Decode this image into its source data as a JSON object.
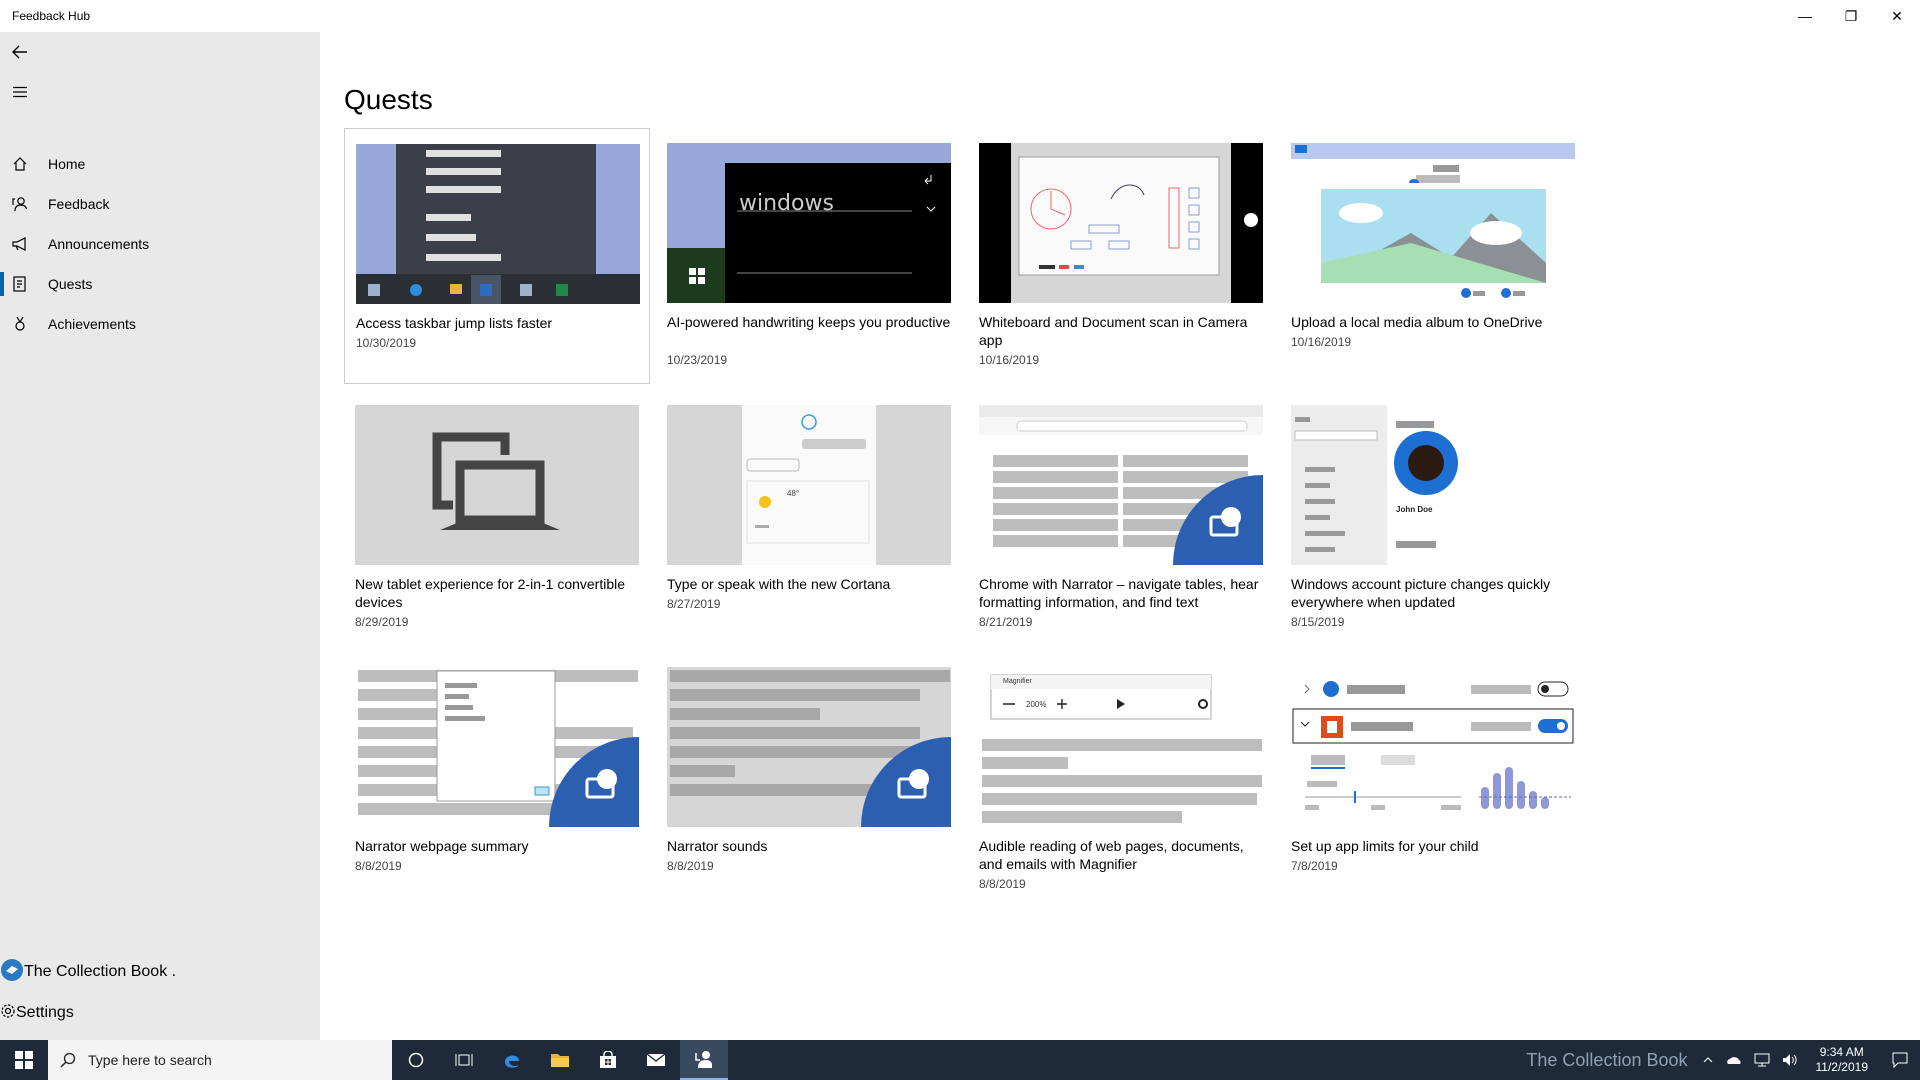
{
  "window": {
    "title": "Feedback Hub",
    "minimize": "—",
    "restore": "❐",
    "close": "✕"
  },
  "sidebar": {
    "items": [
      {
        "label": "Home",
        "icon": "home-icon"
      },
      {
        "label": "Feedback",
        "icon": "feedback-icon"
      },
      {
        "label": "Announcements",
        "icon": "megaphone-icon"
      },
      {
        "label": "Quests",
        "icon": "quest-icon",
        "active": true
      },
      {
        "label": "Achievements",
        "icon": "medal-icon"
      }
    ],
    "account_label": "The Collection Book .",
    "settings_label": "Settings"
  },
  "main": {
    "title": "Quests",
    "cards": [
      {
        "title": "Access taskbar jump lists faster",
        "date": "10/30/2019"
      },
      {
        "title": "AI-powered handwriting keeps you productive",
        "date": "10/23/2019",
        "thumb_text": "windows"
      },
      {
        "title": "Whiteboard and Document scan in Camera app",
        "date": "10/16/2019"
      },
      {
        "title": "Upload a local media album to OneDrive",
        "date": "10/16/2019"
      },
      {
        "title": "New tablet experience for 2-in-1 convertible devices",
        "date": "8/29/2019"
      },
      {
        "title": "Type or speak with the new Cortana",
        "date": "8/27/2019",
        "thumb_text": "48°"
      },
      {
        "title": "Chrome with Narrator – navigate tables, hear formatting information, and find text",
        "date": "8/21/2019"
      },
      {
        "title": "Windows account picture changes quickly everywhere when updated",
        "date": "8/15/2019",
        "thumb_text": "John Doe"
      },
      {
        "title": "Narrator webpage summary",
        "date": "8/8/2019"
      },
      {
        "title": "Narrator sounds",
        "date": "8/8/2019"
      },
      {
        "title": "Audible reading of web pages, documents, and emails with Magnifier",
        "date": "8/8/2019",
        "thumb_text": "Magnifier",
        "thumb_zoom": "200%"
      },
      {
        "title": "Set up app limits for your child",
        "date": "7/8/2019"
      }
    ]
  },
  "taskbar": {
    "search_placeholder": "Type here to search",
    "time": "9:34 AM",
    "date": "11/2/2019",
    "watermark": "The Collection Book"
  },
  "colors": {
    "accent": "#0063b1",
    "sidebar_bg": "#e9e9e9",
    "taskbar_bg": "#1e2a3a",
    "narrator_badge": "#2d5fb0"
  }
}
